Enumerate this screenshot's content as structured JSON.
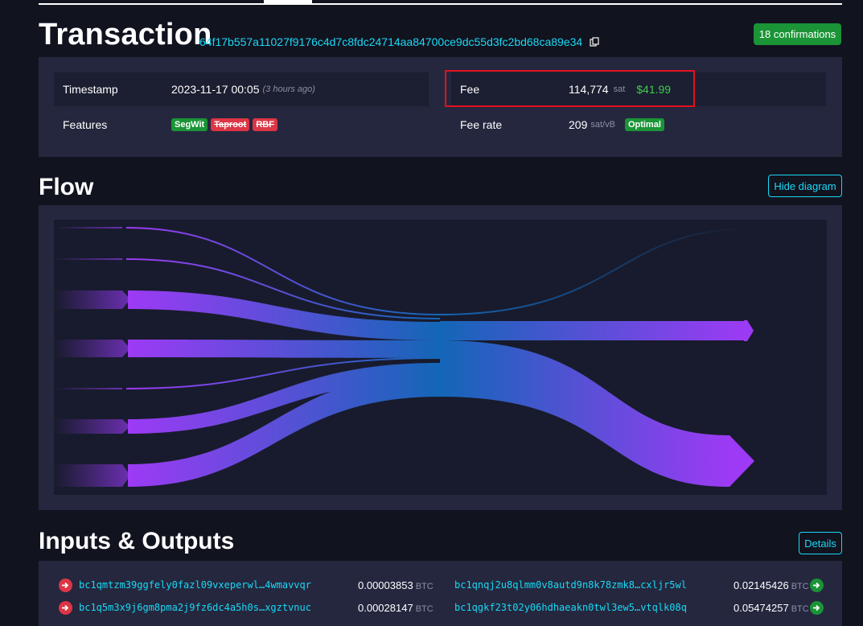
{
  "header": {
    "title": "Transaction",
    "txid": "64f17b557a11027f9176c4d7c8fdc24714aa84700ce9dc55d3fc2bd68ca89e34",
    "confirmations": "18 confirmations"
  },
  "details": {
    "timestamp_label": "Timestamp",
    "timestamp_value": "2023-11-17 00:05",
    "timestamp_ago": "(3 hours ago)",
    "features_label": "Features",
    "features": [
      "SegWit",
      "Taproot",
      "RBF"
    ],
    "fee_label": "Fee",
    "fee_value": "114,774",
    "fee_unit": "sat",
    "fee_usd": "$41.99",
    "feerate_label": "Fee rate",
    "feerate_value": "209",
    "feerate_unit": "sat/vB",
    "feerate_badge": "Optimal"
  },
  "flow": {
    "title": "Flow",
    "hide_button": "Hide diagram"
  },
  "io": {
    "title": "Inputs & Outputs",
    "details_button": "Details",
    "rows": [
      {
        "in_address": "bc1qmtzm39ggfely0fazl09vxeperwl…4wmavvqr",
        "in_amount": "0.00003853",
        "out_address": "bc1qnqj2u8qlmm0v8autd9n8k78zmk8…cxljr5wl",
        "out_amount": "0.02145426"
      },
      {
        "in_address": "bc1q5m3x9j6gm8pma2j9fz6dc4a5h0s…xgztvnuc",
        "in_amount": "0.00028147",
        "out_address": "bc1qgkf23t02y06hdhaeakn0twl3ew5…vtqlk08q",
        "out_amount": "0.05474257"
      }
    ],
    "unit": "BTC"
  },
  "icons": {
    "copy": "copy-icon",
    "input_arrow": "arrow-right-circle-icon",
    "output_arrow": "arrow-right-circle-icon"
  },
  "colors": {
    "accent": "#1bd8f4",
    "success": "#1a9436",
    "danger": "#dc3545",
    "flow_purple": "#9d3af5",
    "flow_blue": "#1366b7",
    "highlight": "#e3101f"
  }
}
